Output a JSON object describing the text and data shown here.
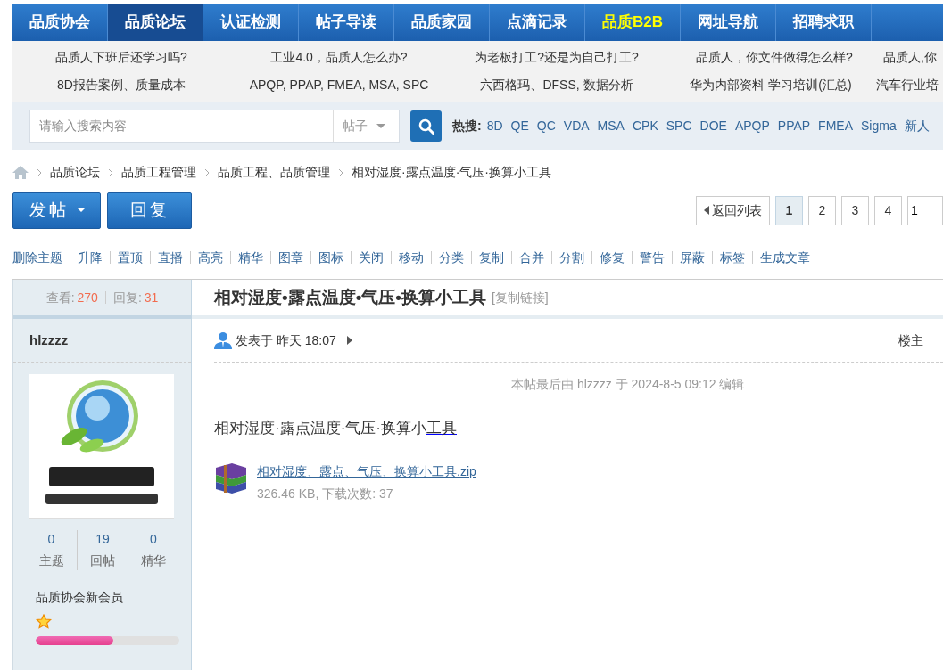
{
  "nav": [
    {
      "label": "品质协会",
      "selected": false,
      "highlighted": false
    },
    {
      "label": "品质论坛",
      "selected": true,
      "highlighted": false
    },
    {
      "label": "认证检测",
      "selected": false,
      "highlighted": false
    },
    {
      "label": "帖子导读",
      "selected": false,
      "highlighted": false
    },
    {
      "label": "品质家园",
      "selected": false,
      "highlighted": false
    },
    {
      "label": "点滴记录",
      "selected": false,
      "highlighted": false
    },
    {
      "label": "品质B2B",
      "selected": false,
      "highlighted": true
    },
    {
      "label": "网址导航",
      "selected": false,
      "highlighted": false
    },
    {
      "label": "招聘求职",
      "selected": false,
      "highlighted": false
    }
  ],
  "quick_links": [
    [
      "品质人下班后还学习吗?",
      "工业4.0，品质人怎么办?",
      "为老板打工?还是为自己打工?",
      "品质人，你文件做得怎么样?",
      "品质人,你"
    ],
    [
      "8D报告案例、质量成本",
      "APQP, PPAP, FMEA, MSA, SPC",
      "六西格玛、DFSS, 数据分析",
      "华为内部资料 学习培训(汇总)",
      "汽车行业培"
    ]
  ],
  "search": {
    "placeholder": "请输入搜索内容",
    "scope": "帖子",
    "hot_label": "热搜:",
    "hot_terms": [
      "8D",
      "QE",
      "QC",
      "VDA",
      "MSA",
      "CPK",
      "SPC",
      "DOE",
      "APQP",
      "PPAP",
      "FMEA",
      "Sigma",
      "新人"
    ]
  },
  "breadcrumb": [
    "品质论坛",
    "品质工程管理",
    "品质工程、品质管理",
    "相对湿度·露点温度·气压·换算小工具"
  ],
  "actions": {
    "new_post": "发帖",
    "reply": "回复"
  },
  "pager": {
    "back": "返回列表",
    "pages": [
      {
        "label": "1",
        "selected": true
      },
      {
        "label": "2",
        "selected": false
      },
      {
        "label": "3",
        "selected": false
      },
      {
        "label": "4",
        "selected": false
      }
    ],
    "page_input": "1"
  },
  "mod_links": [
    "删除主题",
    "升降",
    "置顶",
    "直播",
    "高亮",
    "精华",
    "图章",
    "图标",
    "关闭",
    "移动",
    "分类",
    "复制",
    "合并",
    "分割",
    "修复",
    "警告",
    "屏蔽",
    "标签",
    "生成文章"
  ],
  "post": {
    "views_label": "查看:",
    "views": "270",
    "replies_label": "回复:",
    "replies": "31",
    "title": "相对湿度•露点温度•气压•换算小工具",
    "copy_link": "[复制链接]",
    "author": "hlzzzz",
    "stats": [
      {
        "value": "0",
        "label": "主题"
      },
      {
        "value": "19",
        "label": "回帖"
      },
      {
        "value": "0",
        "label": "精华"
      }
    ],
    "rank": "品质协会新会员",
    "level": 0.54,
    "posted": "发表于 昨天 18:07",
    "floor": "楼主",
    "edit_note": "本帖最后由 hlzzzz 于 2024-8-5 09:12 编辑",
    "body_text": "相对湿度·露点温度·气压·换算小",
    "body_link": "工具",
    "attachment": {
      "name": "相对湿度、露点、气压、换算小工具.zip",
      "info": "326.46 KB, 下载次数: 37"
    }
  }
}
